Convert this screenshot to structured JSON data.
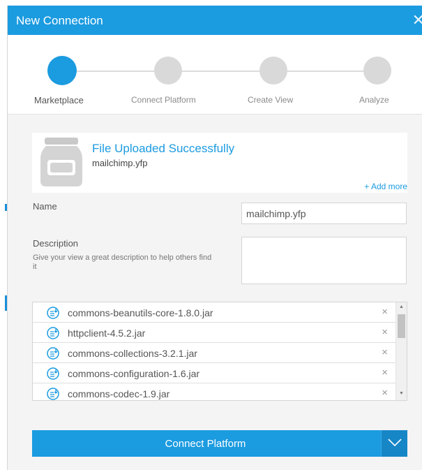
{
  "dialog": {
    "title": "New Connection",
    "close_icon": "close-icon",
    "accent_color": "#1b9be0"
  },
  "steps": [
    {
      "label": "Marketplace",
      "active": true
    },
    {
      "label": "Connect Platform",
      "active": false
    },
    {
      "label": "Create View",
      "active": false
    },
    {
      "label": "Analyze",
      "active": false
    }
  ],
  "upload": {
    "icon": "jar-icon",
    "message": "File Uploaded Successfully",
    "file_name": "mailchimp.yfp",
    "add_more": "+ Add more"
  },
  "form": {
    "name_label": "Name",
    "name_value": "mailchimp.yfp",
    "description_label": "Description",
    "description_hint": "Give your view a great description to help others find it",
    "description_value": ""
  },
  "files": [
    {
      "name": "commons-beanutils-core-1.8.0.jar"
    },
    {
      "name": "httpclient-4.5.2.jar"
    },
    {
      "name": "commons-collections-3.2.1.jar"
    },
    {
      "name": "commons-configuration-1.6.jar"
    },
    {
      "name": "commons-codec-1.9.jar"
    }
  ],
  "file_remove_symbol": "×",
  "footer": {
    "connect_label": "Connect Platform",
    "dropdown_icon": "chevron-down-icon"
  }
}
